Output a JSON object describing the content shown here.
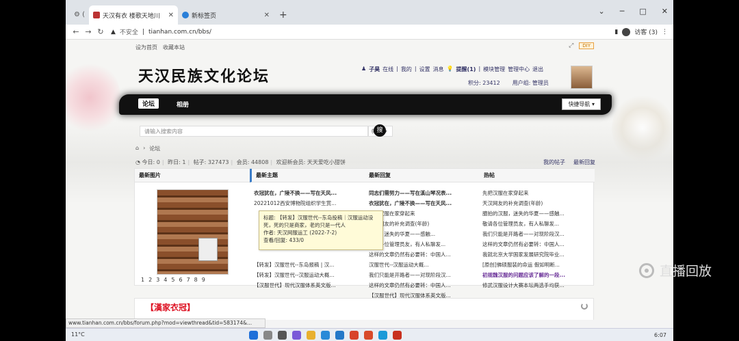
{
  "browser": {
    "tabs": [
      {
        "label": "天汉有衣 楼歌天地川"
      },
      {
        "label": "新标签页"
      }
    ],
    "new_tab": "+",
    "url_warning": "不安全",
    "url": "tianhan.com.cn/bbs/",
    "profile_label": "访客 (3)",
    "status_url": "www.tianhan.com.cn/bbs/forum.php?mod=viewthread&tid=583174&..."
  },
  "site": {
    "toplinks": [
      "设为首页",
      "收藏本站"
    ],
    "diy": "DIY",
    "logo": "天汉民族文化论坛",
    "user": {
      "name": "子昊",
      "links": [
        "在线",
        "我的",
        "设置",
        "消息",
        "提醒(1)",
        "模块管理",
        "管理中心",
        "退出"
      ],
      "points": "积分: 23412",
      "group": "用户组: 管理员"
    },
    "nav": {
      "forum": "论坛",
      "album": "相册",
      "quick": "快捷导航 ▾"
    },
    "search": {
      "placeholder": "请输入搜索内容",
      "select": "帖子 ▾",
      "button": "搜"
    },
    "breadcrumb": "论坛",
    "stats": {
      "today": "今日: 0",
      "yesterday": "昨日: 1",
      "posts": "帖子: 327473",
      "members": "会员: 44808",
      "welcome": "欢迎新会员: 天天爱吃小甜饼"
    },
    "right_links": [
      "我的帖子",
      "最新回复"
    ]
  },
  "panel": {
    "headers": [
      "最新图片",
      "最新主题",
      "最新回复",
      "热帖"
    ],
    "pager": [
      "1",
      "2",
      "3",
      "4",
      "5",
      "6",
      "7",
      "8",
      "9"
    ],
    "new_topics": [
      "衣冠犹在，广陵不换——写在天风...",
      "20221012西安博物院组织学生赏...",
      "",
      "",
      "",
      "",
      "",
      "【转发】汉服世代--东岛报稿 | 汉...",
      "【转发】汉服世代--汉服运动大概...",
      "【汉服世代】现代汉服体系英文版..."
    ],
    "new_replies": [
      "同志们需努力——写在溪山琴况表...",
      "衣冠犹在，广陵不换——写在天风...",
      "先把汉服在家穿起来",
      "天汉网友的补充调查(年龄)",
      "汉服，迷失的华夏——感触...",
      "敬请各位管理员友，有人私聊发...",
      "这样的文章仍然有必要转：中国人...",
      "汉服世代--汉服运动大概...",
      "我们只能是开路者——对现阶段汉...",
      "这样的文章仍然有必要转：中国人...",
      "【汉服世代】现代汉服体系英文版..."
    ],
    "hot": [
      "先把汉服在家穿起来",
      "天汉网友的补充调查(年龄)",
      "臆拍的汉服，迷失的华夏——感触...",
      "敬请各位管理员友，有人私聊发...",
      "我们只能是开路者——对现阶段汉...",
      "这样的文章仍然有必要转：中国人...",
      "我就北京大学国家发展研究院毕业...",
      "[原创]佛硕服装的命运 假如明断...",
      "初规魏汉服的问题应该了解的一段...",
      "修武汉服设计大赛本坛两选手均获..."
    ]
  },
  "tooltip": {
    "title": "标题: 【转发】汉服世代--东岛投稿｜汉服运动没死，死的只是商家，老的只是一代人",
    "author": "作者: 天汉网服运工 (2022-7-2)",
    "views": "查看/回复: 433/0"
  },
  "section2_title": "【漢家衣冠】",
  "taskbar": {
    "weather": "11°C",
    "time": "6:07"
  },
  "overlay": {
    "replay": "直播回放"
  }
}
